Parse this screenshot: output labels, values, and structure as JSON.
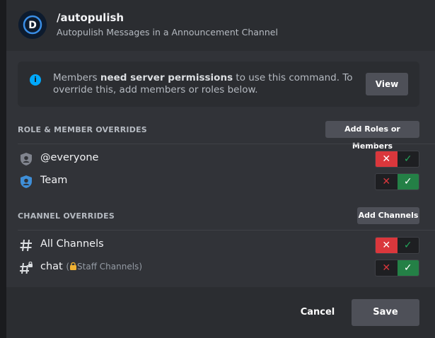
{
  "command": {
    "name": "/autopulish",
    "description": "Autopulish Messages in a Announcement Channel",
    "avatar_letter": "D",
    "avatar_color": "#0d1b2e"
  },
  "notice": {
    "prefix": "Members ",
    "bold": "need server permissions",
    "suffix": " to use this command. To override this, add members or roles below.",
    "view_label": "View",
    "icon": "info-icon"
  },
  "role_overrides": {
    "title": "ROLE & MEMBER OVERRIDES",
    "add_label": "Add Roles or Members",
    "rows": [
      {
        "label": "@everyone",
        "icon": "role-shield-icon",
        "state": "deny"
      },
      {
        "label": "Team",
        "icon": "role-shield-icon",
        "state": "allow"
      }
    ]
  },
  "channel_overrides": {
    "title": "CHANNEL OVERRIDES",
    "add_label": "Add Channels",
    "rows": [
      {
        "label": "All Channels",
        "sub": "",
        "icon": "hash-icon",
        "state": "deny"
      },
      {
        "label": "chat",
        "sub": "Staff Channels",
        "icon": "locked-hash-icon",
        "state": "allow"
      }
    ]
  },
  "footer": {
    "cancel_label": "Cancel",
    "save_label": "Save"
  },
  "colors": {
    "deny": "#da373c",
    "allow": "#248046",
    "info": "#00a8fc"
  }
}
